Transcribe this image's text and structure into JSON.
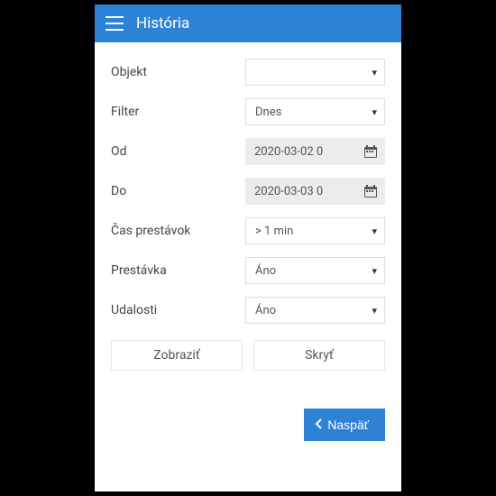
{
  "header": {
    "title": "História"
  },
  "form": {
    "objekt": {
      "label": "Objekt",
      "value": ""
    },
    "filter": {
      "label": "Filter",
      "value": "Dnes"
    },
    "od": {
      "label": "Od",
      "value": "2020-03-02 0"
    },
    "do": {
      "label": "Do",
      "value": "2020-03-03 0"
    },
    "cas": {
      "label": "Čas prestávok",
      "value": "> 1 min"
    },
    "prestavka": {
      "label": "Prestávka",
      "value": "Áno"
    },
    "udalosti": {
      "label": "Udalosti",
      "value": "Áno"
    }
  },
  "buttons": {
    "show": "Zobraziť",
    "hide": "Skryť",
    "back": "Naspäť"
  }
}
